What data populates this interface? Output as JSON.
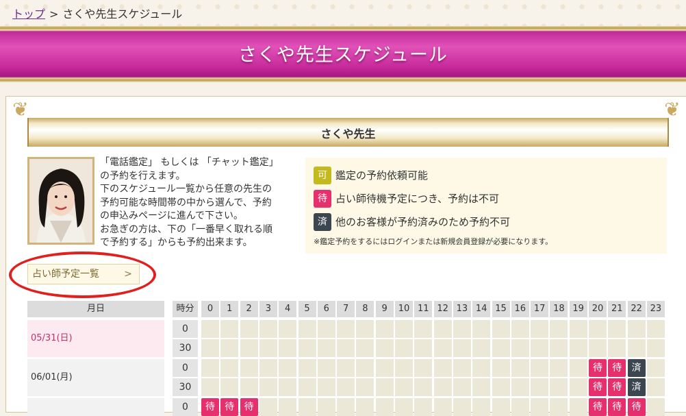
{
  "breadcrumb": {
    "home": "トップ",
    "separator": ">",
    "current": "さくや先生スケジュール"
  },
  "banner": {
    "title": "さくや先生スケジュール"
  },
  "section": {
    "title": "さくや先生"
  },
  "description": {
    "lines": [
      "「電話鑑定」 もしくは 「チャット鑑定」",
      "の予約を行えます。",
      "下のスケジュール一覧から任意の先生の",
      "予約可能な時間帯の中から選んで、予約",
      "の申込みページに進んで下さい。",
      "お急ぎの方は、下の「一番早く取れる順",
      "で予約する」からも予約出来ます。"
    ]
  },
  "legend": {
    "items": [
      {
        "badge": "可",
        "text": "鑑定の予約依頼可能",
        "type": "ok"
      },
      {
        "badge": "待",
        "text": "占い師待機予定につき、予約は不可",
        "type": "wait"
      },
      {
        "badge": "済",
        "text": "他のお客様が予約済みのため予約不可",
        "type": "done"
      }
    ],
    "note": "※鑑定予約をするにはログインまたは新規会員登録が必要になります。"
  },
  "list_button": {
    "label": "占い師予定一覧",
    "chevron": ">"
  },
  "schedule": {
    "date_header": "月日",
    "minute_header": "時分",
    "hours": [
      "0",
      "1",
      "2",
      "3",
      "4",
      "5",
      "6",
      "7",
      "8",
      "9",
      "10",
      "11",
      "12",
      "13",
      "14",
      "15",
      "16",
      "17",
      "18",
      "19",
      "20",
      "21",
      "22",
      "23"
    ],
    "rows": [
      {
        "date": "05/31(日)",
        "date_color": "#c0306a",
        "date_bg": "#fdeaf0",
        "slots": [
          {
            "minute": "0",
            "cells": {}
          },
          {
            "minute": "30",
            "cells": {}
          }
        ]
      },
      {
        "date": "06/01(月)",
        "date_color": "#333333",
        "date_bg": "#f2f2f2",
        "slots": [
          {
            "minute": "0",
            "cells": {
              "20": "待",
              "21": "待",
              "22": "済"
            }
          },
          {
            "minute": "30",
            "cells": {
              "20": "待",
              "21": "待",
              "22": "済"
            }
          }
        ]
      },
      {
        "date": "",
        "date_color": "#333333",
        "date_bg": "#f2f2f2",
        "slots": [
          {
            "minute": "0",
            "cells": {
              "0": "待",
              "1": "待",
              "2": "待",
              "20": "待",
              "21": "待",
              "22": "待"
            }
          }
        ]
      }
    ]
  },
  "colors": {
    "wait": "#e6306e",
    "done": "#3c4650",
    "ok": "#c4b91e",
    "banner": "#c72a9b"
  }
}
